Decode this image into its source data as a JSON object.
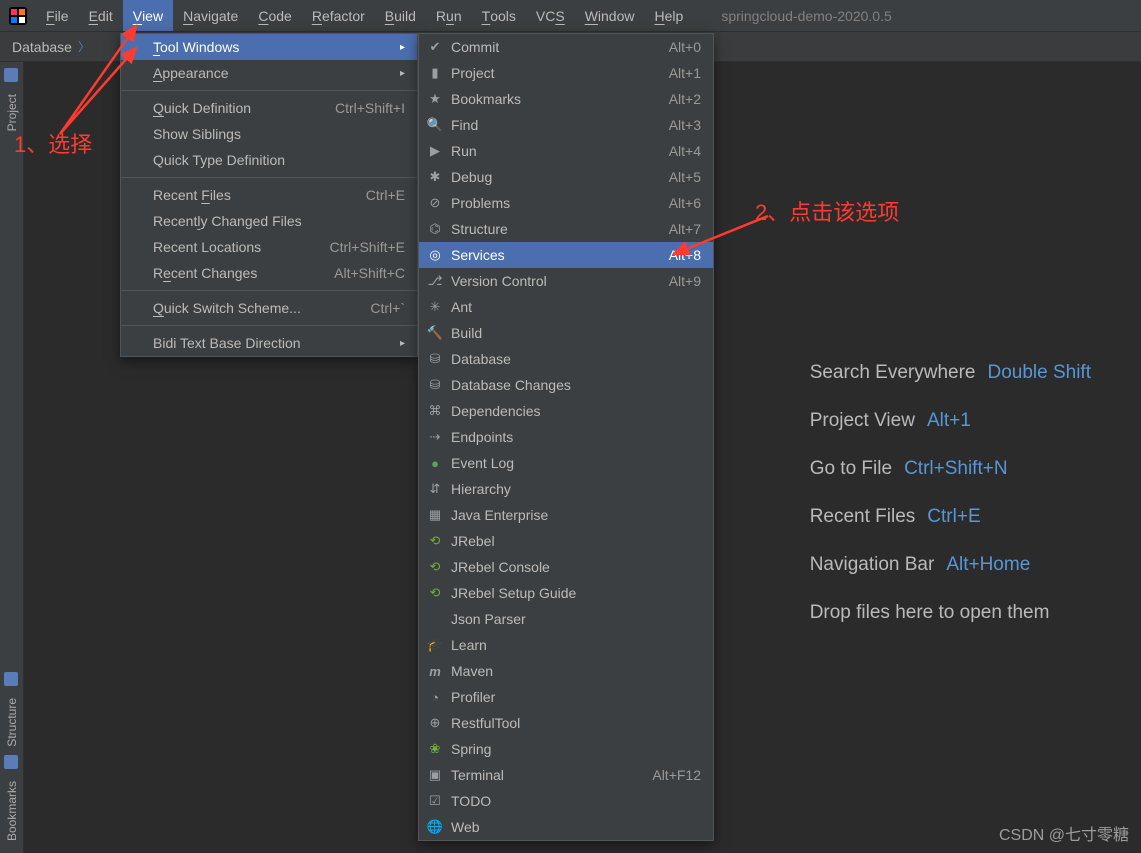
{
  "app": {
    "project_title": "springcloud-demo-2020.0.5"
  },
  "menubar": {
    "items": [
      {
        "label": "File",
        "accel_html": "<span class='underline'>F</span>ile"
      },
      {
        "label": "Edit",
        "accel_html": "<span class='underline'>E</span>dit"
      },
      {
        "label": "View",
        "accel_html": "<span class='underline'>V</span>iew",
        "selected": true
      },
      {
        "label": "Navigate",
        "accel_html": "<span class='underline'>N</span>avigate"
      },
      {
        "label": "Code",
        "accel_html": "<span class='underline'>C</span>ode"
      },
      {
        "label": "Refactor",
        "accel_html": "<span class='underline'>R</span>efactor"
      },
      {
        "label": "Build",
        "accel_html": "<span class='underline'>B</span>uild"
      },
      {
        "label": "Run",
        "accel_html": "R<span class='underline'>u</span>n"
      },
      {
        "label": "Tools",
        "accel_html": "<span class='underline'>T</span>ools"
      },
      {
        "label": "VCS",
        "accel_html": "VC<span class='underline'>S</span>"
      },
      {
        "label": "Window",
        "accel_html": "<span class='underline'>W</span>indow"
      },
      {
        "label": "Help",
        "accel_html": "<span class='underline'>H</span>elp"
      }
    ]
  },
  "breadcrumb": {
    "path": [
      "Database"
    ]
  },
  "left_strip": {
    "top": [
      {
        "label": "Project",
        "icon": "project"
      }
    ],
    "bottom": [
      {
        "label": "Structure",
        "icon": "structure"
      },
      {
        "label": "Bookmarks",
        "icon": "bookmark"
      }
    ]
  },
  "view_menu": {
    "groups": [
      [
        {
          "label_html": "<span class='underline'>T</span>ool Windows",
          "submenu": true,
          "highlight": true
        },
        {
          "label_html": "<span class='underline'>A</span>ppearance",
          "submenu": true
        }
      ],
      [
        {
          "label_html": "<span class='underline'>Q</span>uick Definition",
          "shortcut": "Ctrl+Shift+I"
        },
        {
          "label_html": "Show Siblings"
        },
        {
          "label_html": "Quick Type Definition"
        }
      ],
      [
        {
          "label_html": "Recent <span class='underline'>F</span>iles",
          "shortcut": "Ctrl+E"
        },
        {
          "label_html": "Recent<span class='underline'>l</span>y Changed Files"
        },
        {
          "label_html": "Recent Locations",
          "shortcut": "Ctrl+Shift+E"
        },
        {
          "label_html": "R<span class='underline'>e</span>cent Changes",
          "shortcut": "Alt+Shift+C"
        }
      ],
      [
        {
          "label_html": "<span class='underline'>Q</span>uick Switch Scheme...",
          "shortcut": "Ctrl+`"
        }
      ],
      [
        {
          "label_html": "Bidi Text Base Direction",
          "submenu": true
        }
      ]
    ]
  },
  "tool_windows_menu": {
    "items": [
      {
        "label": "Commit",
        "shortcut": "Alt+0",
        "icon": "✔"
      },
      {
        "label": "Project",
        "shortcut": "Alt+1",
        "icon": "▮"
      },
      {
        "label": "Bookmarks",
        "shortcut": "Alt+2",
        "icon": "★"
      },
      {
        "label": "Find",
        "shortcut": "Alt+3",
        "icon": "🔍"
      },
      {
        "label": "Run",
        "shortcut": "Alt+4",
        "icon": "▶"
      },
      {
        "label": "Debug",
        "shortcut": "Alt+5",
        "icon": "✱"
      },
      {
        "label": "Problems",
        "shortcut": "Alt+6",
        "icon": "⊘"
      },
      {
        "label": "Structure",
        "shortcut": "Alt+7",
        "icon": "⌬"
      },
      {
        "label": "Services",
        "shortcut": "Alt+8",
        "icon": "◎",
        "highlight": true
      },
      {
        "label": "Version Control",
        "shortcut": "Alt+9",
        "icon": "⎇"
      },
      {
        "label": "Ant",
        "icon": "✳"
      },
      {
        "label": "Build",
        "icon": "🔨"
      },
      {
        "label": "Database",
        "icon": "⛁"
      },
      {
        "label": "Database Changes",
        "icon": "⛁"
      },
      {
        "label": "Dependencies",
        "icon": "⌘"
      },
      {
        "label": "Endpoints",
        "icon": "⇢"
      },
      {
        "label": "Event Log",
        "icon": "●",
        "icon_color": "#5fa05f"
      },
      {
        "label": "Hierarchy",
        "icon": "⇵"
      },
      {
        "label": "Java Enterprise",
        "icon": "▦"
      },
      {
        "label": "JRebel",
        "icon": "⟲",
        "icon_color": "#6fae3b"
      },
      {
        "label": "JRebel Console",
        "icon": "⟲",
        "icon_color": "#6fae3b"
      },
      {
        "label": "JRebel Setup Guide",
        "icon": "⟲",
        "icon_color": "#6fae3b"
      },
      {
        "label": "Json Parser"
      },
      {
        "label": "Learn",
        "icon": "🎓"
      },
      {
        "label": "Maven",
        "icon": "m",
        "icon_style": "font-style:italic;font-weight:bold;"
      },
      {
        "label": "Profiler",
        "icon": "◔"
      },
      {
        "label": "RestfulTool",
        "icon": "⊕"
      },
      {
        "label": "Spring",
        "icon": "❀",
        "icon_color": "#6db33f"
      },
      {
        "label": "Terminal",
        "shortcut": "Alt+F12",
        "icon": "▣"
      },
      {
        "label": "TODO",
        "icon": "☑"
      },
      {
        "label": "Web",
        "icon": "🌐"
      }
    ]
  },
  "editor_hints": [
    {
      "label": "Search Everywhere",
      "key": "Double Shift"
    },
    {
      "label": "Project View",
      "key": "Alt+1"
    },
    {
      "label": "Go to File",
      "key": "Ctrl+Shift+N"
    },
    {
      "label": "Recent Files",
      "key": "Ctrl+E"
    },
    {
      "label": "Navigation Bar",
      "key": "Alt+Home"
    },
    {
      "label": "Drop files here to open them"
    }
  ],
  "annotations": {
    "ann1": "1、选择",
    "ann2": "2、点击该选项"
  },
  "watermark": "CSDN @七寸零糖"
}
